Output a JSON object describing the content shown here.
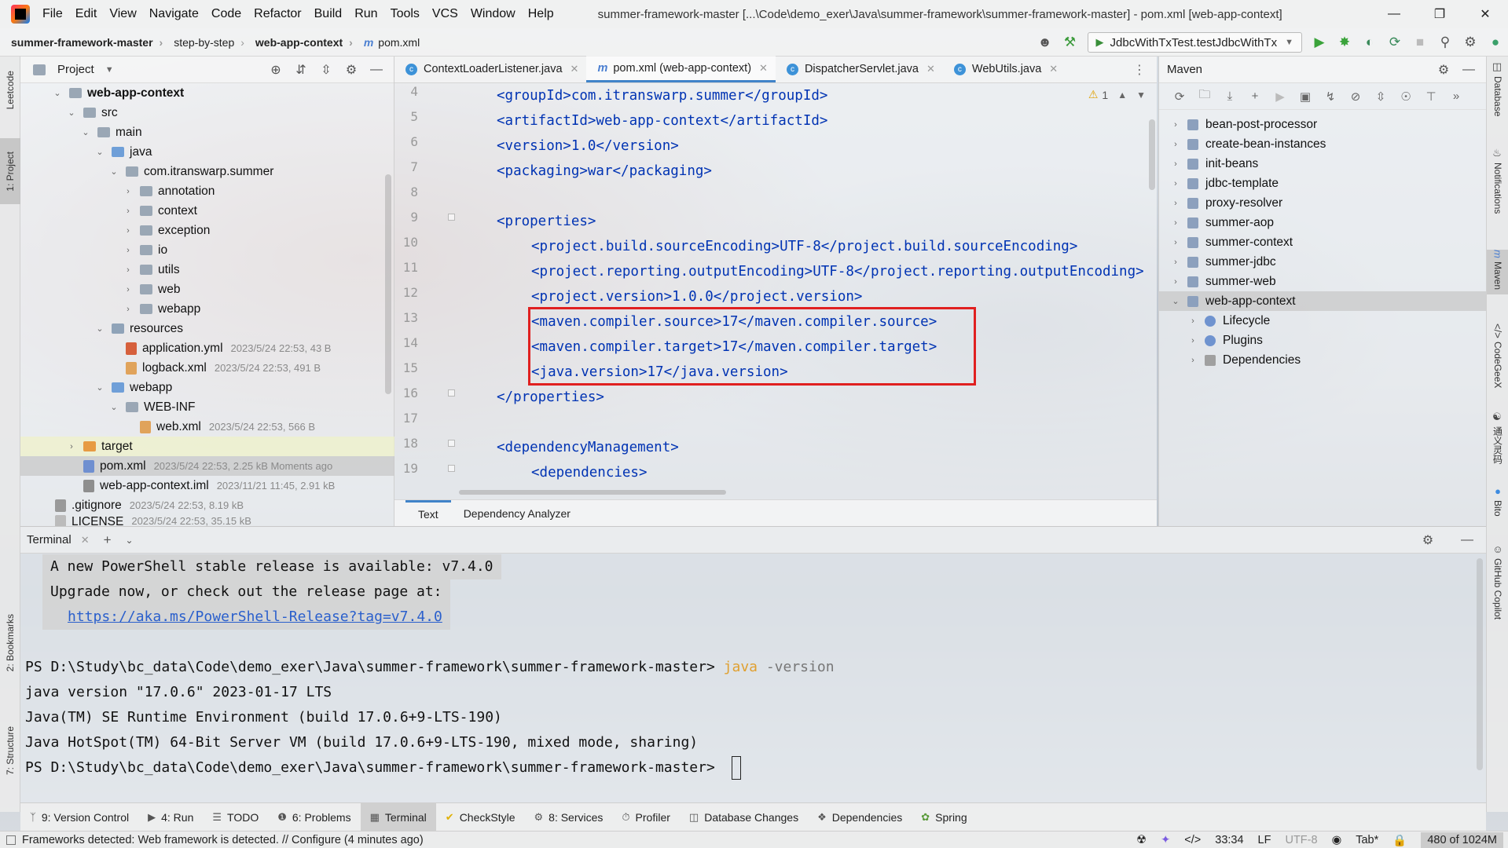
{
  "menubar": {
    "items": [
      "File",
      "Edit",
      "View",
      "Navigate",
      "Code",
      "Refactor",
      "Build",
      "Run",
      "Tools",
      "VCS",
      "Window",
      "Help"
    ],
    "window_title": "summer-framework-master [...\\Code\\demo_exer\\Java\\summer-framework\\summer-framework-master] - pom.xml [web-app-context]"
  },
  "navbar": {
    "crumbs": [
      "summer-framework-master",
      "step-by-step",
      "web-app-context",
      "pom.xml"
    ],
    "run_config": "JdbcWithTxTest.testJdbcWithTx"
  },
  "left_strip": {
    "tabs": [
      "Leetcode",
      "1: Project",
      "2: Bookmarks",
      "7: Structure"
    ]
  },
  "project": {
    "title": "Project",
    "tree": [
      {
        "label": "web-app-context",
        "meta": ""
      },
      {
        "label": "src",
        "meta": ""
      },
      {
        "label": "main",
        "meta": ""
      },
      {
        "label": "java",
        "meta": ""
      },
      {
        "label": "com.itranswarp.summer",
        "meta": ""
      },
      {
        "label": "annotation",
        "meta": ""
      },
      {
        "label": "context",
        "meta": ""
      },
      {
        "label": "exception",
        "meta": ""
      },
      {
        "label": "io",
        "meta": ""
      },
      {
        "label": "utils",
        "meta": ""
      },
      {
        "label": "web",
        "meta": ""
      },
      {
        "label": "webapp",
        "meta": ""
      },
      {
        "label": "resources",
        "meta": ""
      },
      {
        "label": "application.yml",
        "meta": "2023/5/24 22:53, 43 B"
      },
      {
        "label": "logback.xml",
        "meta": "2023/5/24 22:53, 491 B"
      },
      {
        "label": "webapp",
        "meta": ""
      },
      {
        "label": "WEB-INF",
        "meta": ""
      },
      {
        "label": "web.xml",
        "meta": "2023/5/24 22:53, 566 B"
      },
      {
        "label": "target",
        "meta": ""
      },
      {
        "label": "pom.xml",
        "meta": "2023/5/24 22:53, 2.25 kB Moments ago"
      },
      {
        "label": "web-app-context.iml",
        "meta": "2023/11/21 11:45, 2.91 kB"
      },
      {
        "label": ".gitignore",
        "meta": "2023/5/24 22:53, 8.19 kB"
      },
      {
        "label": "LICENSE",
        "meta": "2023/5/24 22:53, 35.15 kB"
      }
    ]
  },
  "editor": {
    "tabs": [
      {
        "label": "ContextLoaderListener.java"
      },
      {
        "label": "pom.xml (web-app-context)"
      },
      {
        "label": "DispatcherServlet.java"
      },
      {
        "label": "WebUtils.java"
      }
    ],
    "inspection_count": "1",
    "lines": [
      {
        "n": "4",
        "text": "<groupId>com.itranswarp.summer</groupId>"
      },
      {
        "n": "5",
        "text": "<artifactId>web-app-context</artifactId>"
      },
      {
        "n": "6",
        "text": "<version>1.0</version>"
      },
      {
        "n": "7",
        "text": "<packaging>war</packaging>"
      },
      {
        "n": "8",
        "text": ""
      },
      {
        "n": "9",
        "text": "<properties>"
      },
      {
        "n": "10",
        "text": "<project.build.sourceEncoding>UTF-8</project.build.sourceEncoding>"
      },
      {
        "n": "11",
        "text": "<project.reporting.outputEncoding>UTF-8</project.reporting.outputEncoding>"
      },
      {
        "n": "12",
        "text": "<project.version>1.0.0</project.version>"
      },
      {
        "n": "13",
        "text": "<maven.compiler.source>17</maven.compiler.source>"
      },
      {
        "n": "14",
        "text": "<maven.compiler.target>17</maven.compiler.target>"
      },
      {
        "n": "15",
        "text": "<java.version>17</java.version>"
      },
      {
        "n": "16",
        "text": "</properties>"
      },
      {
        "n": "17",
        "text": ""
      },
      {
        "n": "18",
        "text": "<dependencyManagement>"
      },
      {
        "n": "19",
        "text": "<dependencies>"
      }
    ],
    "bottom_tabs": [
      "Text",
      "Dependency Analyzer"
    ]
  },
  "maven": {
    "title": "Maven",
    "items": [
      {
        "label": "bean-post-processor"
      },
      {
        "label": "create-bean-instances"
      },
      {
        "label": "init-beans"
      },
      {
        "label": "jdbc-template"
      },
      {
        "label": "proxy-resolver"
      },
      {
        "label": "summer-aop"
      },
      {
        "label": "summer-context"
      },
      {
        "label": "summer-jdbc"
      },
      {
        "label": "summer-web"
      },
      {
        "label": "web-app-context"
      },
      {
        "label": "Lifecycle"
      },
      {
        "label": "Plugins"
      },
      {
        "label": "Dependencies"
      }
    ]
  },
  "right_strip": {
    "tabs": [
      "Database",
      "Notifications",
      "Maven",
      "CodeGeeX",
      "通义灵码",
      "Bito",
      "GitHub Copilot"
    ]
  },
  "terminal": {
    "title": "Terminal",
    "banner": [
      "A new PowerShell stable release is available: v7.4.0",
      "Upgrade now, or check out the release page at:",
      "https://aka.ms/PowerShell-Release?tag=v7.4.0"
    ],
    "prompt": "PS D:\\Study\\bc_data\\Code\\demo_exer\\Java\\summer-framework\\summer-framework-master> ",
    "command": "java",
    "command_arg": " -version",
    "output": [
      "java version \"17.0.6\" 2023-01-17 LTS",
      "Java(TM) SE Runtime Environment (build 17.0.6+9-LTS-190)",
      "Java HotSpot(TM) 64-Bit Server VM (build 17.0.6+9-LTS-190, mixed mode, sharing)"
    ]
  },
  "toolwindows": [
    {
      "label": "9: Version Control"
    },
    {
      "label": "4: Run"
    },
    {
      "label": "TODO"
    },
    {
      "label": "6: Problems"
    },
    {
      "label": "Terminal"
    },
    {
      "label": "CheckStyle"
    },
    {
      "label": "8: Services"
    },
    {
      "label": "Profiler"
    },
    {
      "label": "Database Changes"
    },
    {
      "label": "Dependencies"
    },
    {
      "label": "Spring"
    }
  ],
  "statusbar": {
    "message": "Frameworks detected: Web framework is detected. // Configure (4 minutes ago)",
    "position": "33:34",
    "line_sep": "LF",
    "encoding": "UTF-8",
    "indent": "Tab*",
    "memory": "480 of 1024M"
  },
  "colors": {
    "xml_tag": "#0033b3",
    "highlight_box": "#e02020",
    "link": "#2a5fcc",
    "command": "#e0a030"
  }
}
